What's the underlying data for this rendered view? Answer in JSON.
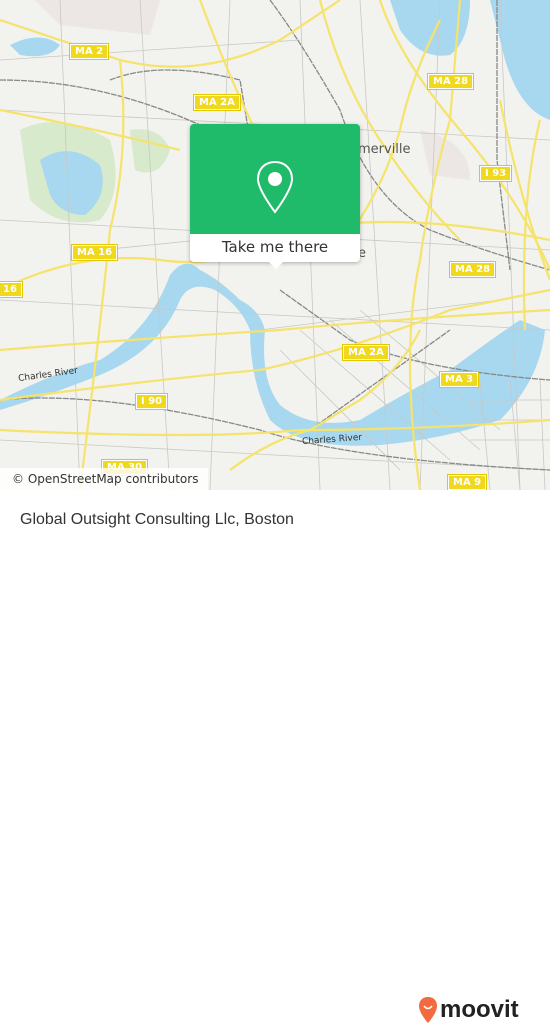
{
  "map": {
    "shields": [
      {
        "id": "ma2",
        "label": "MA 2"
      },
      {
        "id": "ma2a-n",
        "label": "MA 2A"
      },
      {
        "id": "ma28-n",
        "label": "MA 28"
      },
      {
        "id": "i93",
        "label": "I 93"
      },
      {
        "id": "ma16",
        "label": "MA 16"
      },
      {
        "id": "16-w",
        "label": "16"
      },
      {
        "id": "ma28-s",
        "label": "MA 28"
      },
      {
        "id": "ma2a-s",
        "label": "MA 2A"
      },
      {
        "id": "ma3",
        "label": "MA 3"
      },
      {
        "id": "i90",
        "label": "I 90"
      },
      {
        "id": "ma30",
        "label": "MA 30"
      },
      {
        "id": "ma9",
        "label": "MA 9"
      }
    ],
    "place_labels": [
      "merville",
      "e"
    ],
    "water_labels": [
      "Charles River",
      "Charles River"
    ],
    "colors": {
      "water": "#a8d8f0",
      "road": "#f5e36b",
      "land": "#f2f2ee",
      "park": "#d8eacc"
    }
  },
  "popup": {
    "button_label": "Take me there",
    "icon": "map-pin-icon",
    "color": "#1fba6a"
  },
  "attribution": "© OpenStreetMap contributors",
  "footer": {
    "place_name": "Global Outsight Consulting Llc, Boston",
    "brand": "moovit",
    "brand_color": "#f26a3d"
  }
}
